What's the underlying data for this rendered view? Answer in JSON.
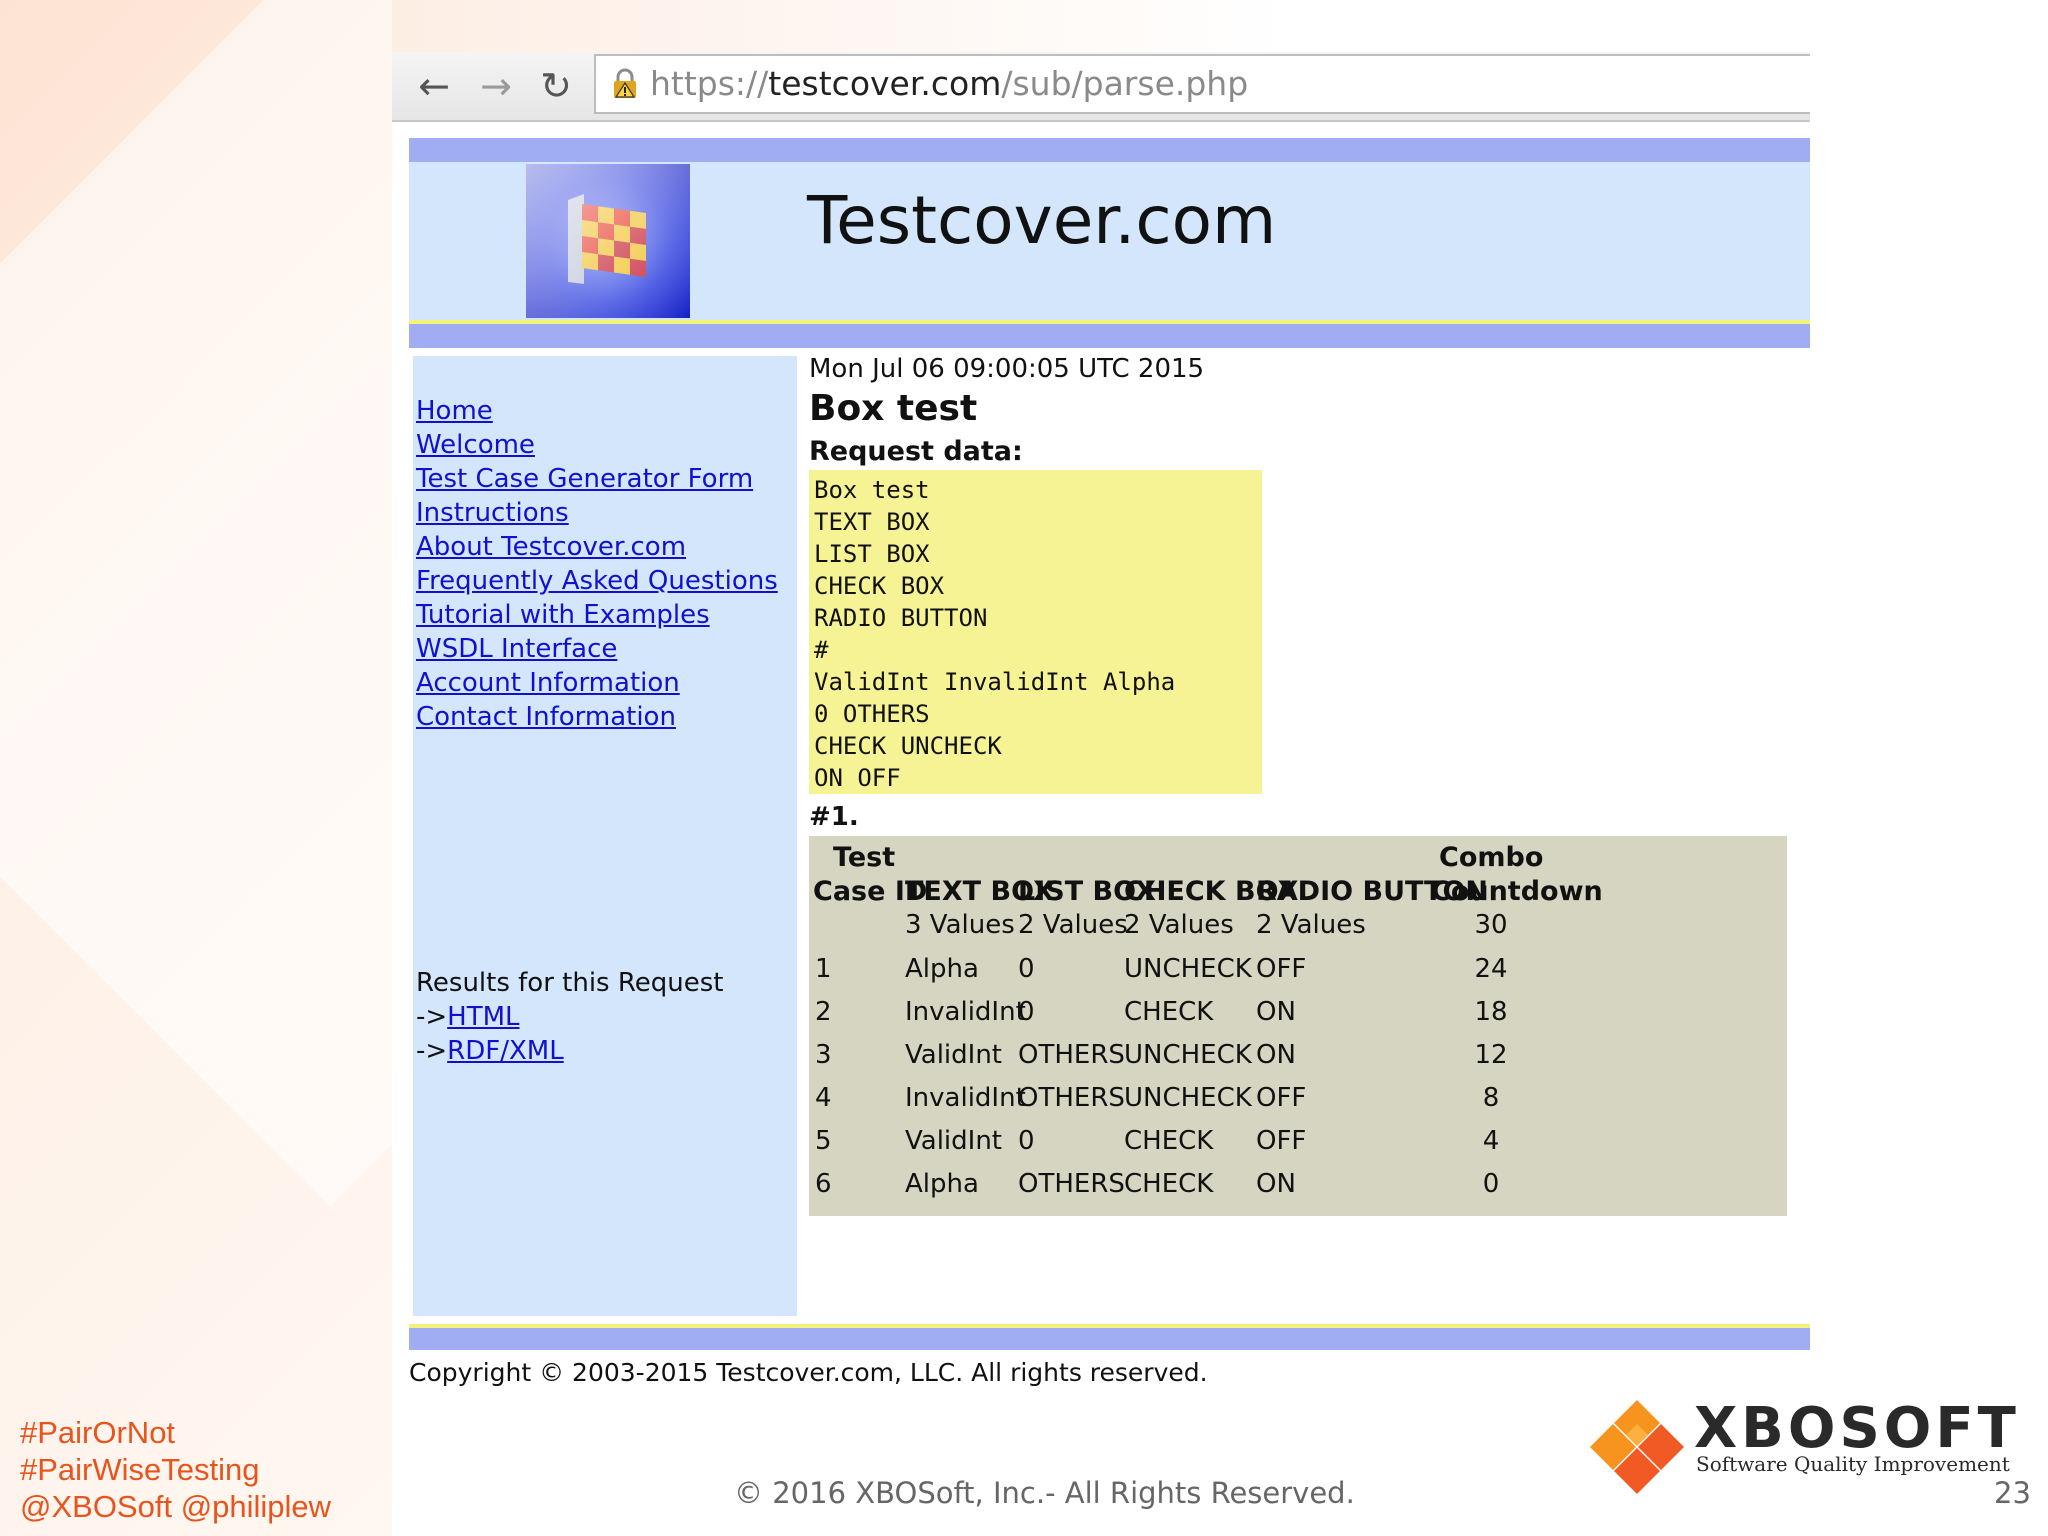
{
  "browser": {
    "url_scheme": "https://",
    "url_host": "testcover.com",
    "url_path": "/sub/parse.php"
  },
  "site": {
    "title": "Testcover.com"
  },
  "sidebar": {
    "links": [
      "Home",
      "Welcome",
      "Test Case Generator Form",
      "Instructions",
      "About Testcover.com",
      "Frequently Asked Questions",
      "Tutorial with Examples",
      "WSDL Interface",
      "Account Information",
      "Contact Information"
    ],
    "results_label": "Results for this Request",
    "arrow": "->",
    "html_link": "HTML",
    "rdf_link": "RDF/XML"
  },
  "main": {
    "date": "Mon Jul 06 09:00:05 UTC 2015",
    "heading": "Box test",
    "request_label": "Request data:",
    "request_lines": [
      "Box test",
      "TEXT BOX",
      "LIST BOX",
      "CHECK BOX",
      "RADIO BUTTON",
      "#",
      "ValidInt InvalidInt Alpha",
      "0 OTHERS",
      "CHECK UNCHECK",
      "ON OFF"
    ],
    "result_number": "#1."
  },
  "table": {
    "header_row1": [
      "Test",
      "",
      "",
      "",
      "",
      "Combo"
    ],
    "header_row2": [
      "Case ID",
      "TEXT BOX",
      "LIST BOX",
      "CHECK BOX",
      "RADIO BUTTON",
      "Countdown"
    ],
    "values_row": [
      "",
      "3 Values",
      "2 Values",
      "2 Values",
      "2 Values",
      "30"
    ],
    "rows": [
      [
        "1",
        "Alpha",
        "0",
        "UNCHECK",
        "OFF",
        "24"
      ],
      [
        "2",
        "InvalidInt",
        "0",
        "CHECK",
        "ON",
        "18"
      ],
      [
        "3",
        "ValidInt",
        "OTHERS",
        "UNCHECK",
        "ON",
        "12"
      ],
      [
        "4",
        "InvalidInt",
        "OTHERS",
        "UNCHECK",
        "OFF",
        "8"
      ],
      [
        "5",
        "ValidInt",
        "0",
        "CHECK",
        "OFF",
        "4"
      ],
      [
        "6",
        "Alpha",
        "OTHERS",
        "CHECK",
        "ON",
        "0"
      ]
    ]
  },
  "footer": {
    "copyright": "Copyright © 2003-2015 Testcover.com, LLC. All rights reserved."
  },
  "slide": {
    "hashtags": [
      "#PairOrNot",
      "#PairWiseTesting",
      "@XBOSoft @philiplew"
    ],
    "copyright": "© 2016 XBOSoft, Inc.- All Rights Reserved.",
    "brand_name": "XBOSOFT",
    "brand_tagline": "Software Quality Improvement",
    "page_number": "23"
  }
}
